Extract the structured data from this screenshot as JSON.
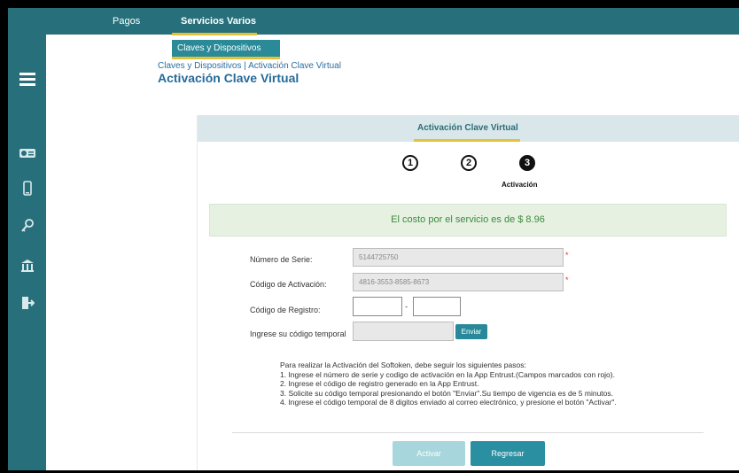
{
  "nav": {
    "pagos": "Pagos",
    "servicios": "Servicios Varios"
  },
  "submenu": {
    "claves": "Claves y Dispositivos"
  },
  "breadcrumb": "Claves y Dispositivos | Activación Clave Virtual",
  "page_title": "Activación Clave Virtual",
  "card": {
    "header_title": "Activación Clave Virtual",
    "steps": [
      "1",
      "2",
      "3"
    ],
    "active_step_label": "Activación",
    "cost_message": "El costo por el servicio es de $ 8.96"
  },
  "form": {
    "serie_label": "Número de Serie:",
    "serie_value": "5144725750",
    "activacion_label": "Código de Activación:",
    "activacion_value": "4816-3553-8585-8673",
    "registro_label": "Código de Registro:",
    "registro_dash": "-",
    "temporal_label": "Ingrese su código temporal",
    "required_mark": "*",
    "enviar": "Enviar"
  },
  "instructions": [
    "Para realizar la Activación del Softoken, debe seguir los siguientes pasos:",
    "1. Ingrese el número de serie y codigo de activación en la App Entrust.(Campos marcados con rojo).",
    "2. Ingrese el código de registro generado en la App Entrust.",
    "3. Solicite su código temporal presionando el botón \"Enviar\".Su tiempo de vigencia es de 5 minutos.",
    "4. Ingrese el código temporal de 8 digitos enviado al correo electrónico, y presione el botón \"Activar\"."
  ],
  "buttons": {
    "activar": "Activar",
    "regresar": "Regresar"
  },
  "icons": [
    "menu-icon",
    "card-icon",
    "mobile-icon",
    "key-icon",
    "bank-icon",
    "logout-icon"
  ],
  "colors": {
    "primary": "#27707b",
    "accent": "#e3c23a",
    "success": "#3c8a3c"
  }
}
